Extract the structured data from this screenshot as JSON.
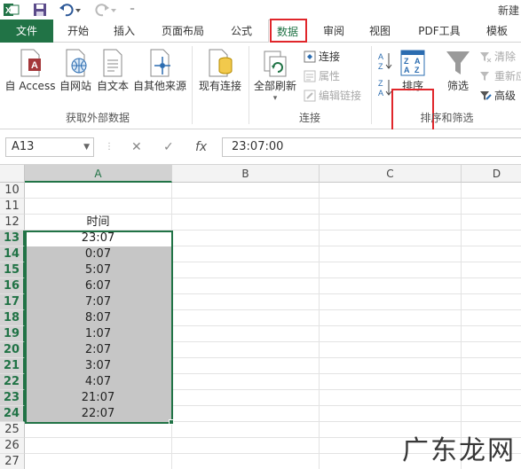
{
  "app": {
    "title_partial": "新建"
  },
  "tabs": [
    {
      "id": "file",
      "label": "文件"
    },
    {
      "id": "home",
      "label": "开始"
    },
    {
      "id": "insert",
      "label": "插入"
    },
    {
      "id": "layout",
      "label": "页面布局"
    },
    {
      "id": "formulas",
      "label": "公式"
    },
    {
      "id": "data",
      "label": "数据"
    },
    {
      "id": "review",
      "label": "审阅"
    },
    {
      "id": "view",
      "label": "视图"
    },
    {
      "id": "pdf",
      "label": "PDF工具"
    },
    {
      "id": "template",
      "label": "模板"
    }
  ],
  "ribbon": {
    "get_external": {
      "access": "自 Access",
      "web": "自网站",
      "text": "自文本",
      "other": "自其他来源",
      "group_label": "获取外部数据"
    },
    "existing_connections": "现有连接",
    "connections": {
      "refresh_all": "全部刷新",
      "connections": "连接",
      "properties": "属性",
      "edit_links": "编辑链接",
      "group_label": "连接"
    },
    "sort_filter": {
      "sort_az": "A↓Z",
      "sort_za": "Z↓A",
      "sort": "排序",
      "filter": "筛选",
      "clear": "清除",
      "reapply": "重新应用",
      "advanced": "高级",
      "group_label": "排序和筛选"
    }
  },
  "formula_bar": {
    "name_box": "A13",
    "cancel": "✕",
    "enter": "✓",
    "fx": "fx",
    "formula": "23:07:00"
  },
  "grid": {
    "columns": [
      "A",
      "B",
      "C",
      "D"
    ],
    "rows": [
      {
        "num": "10",
        "a": ""
      },
      {
        "num": "11",
        "a": ""
      },
      {
        "num": "12",
        "a": "时间"
      },
      {
        "num": "13",
        "a": "23:07"
      },
      {
        "num": "14",
        "a": "0:07"
      },
      {
        "num": "15",
        "a": "5:07"
      },
      {
        "num": "16",
        "a": "6:07"
      },
      {
        "num": "17",
        "a": "7:07"
      },
      {
        "num": "18",
        "a": "8:07"
      },
      {
        "num": "19",
        "a": "1:07"
      },
      {
        "num": "20",
        "a": "2:07"
      },
      {
        "num": "21",
        "a": "3:07"
      },
      {
        "num": "22",
        "a": "4:07"
      },
      {
        "num": "23",
        "a": "21:07"
      },
      {
        "num": "24",
        "a": "22:07"
      },
      {
        "num": "25",
        "a": ""
      },
      {
        "num": "26",
        "a": ""
      },
      {
        "num": "27",
        "a": ""
      }
    ]
  },
  "watermark": "广东龙网",
  "colors": {
    "excel_green": "#217346",
    "highlight_red": "#e0262b",
    "selection_gray": "#c6c6c6"
  }
}
